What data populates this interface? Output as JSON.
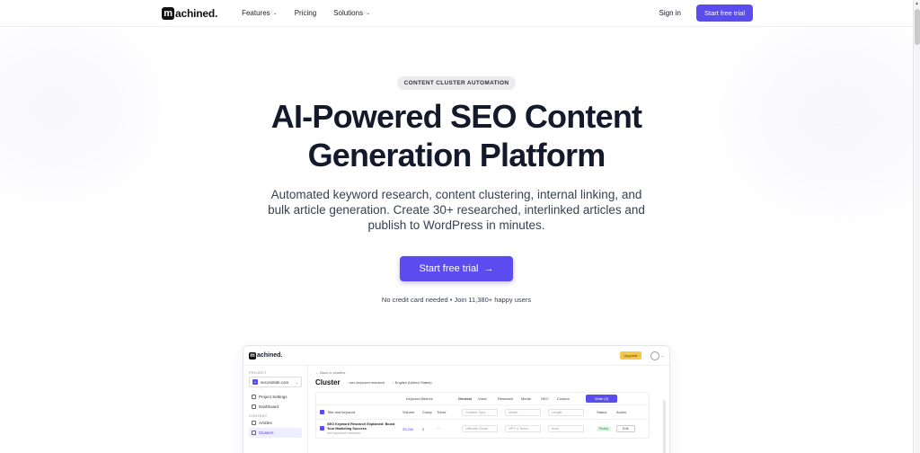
{
  "nav": {
    "logo_letter": "m",
    "logo_rest": "achined.",
    "links": [
      {
        "label": "Features",
        "chevron": true
      },
      {
        "label": "Pricing",
        "chevron": false
      },
      {
        "label": "Solutions",
        "chevron": true
      }
    ],
    "signin": "Sign in",
    "cta": "Start free trial"
  },
  "hero": {
    "badge": "CONTENT CLUSTER AUTOMATION",
    "title_line1": "AI-Powered SEO Content",
    "title_line2": "Generation Platform",
    "subtitle": "Automated keyword research, content clustering, internal linking, and bulk article generation. Create 30+ researched, interlinked articles and publish to WordPress in minutes.",
    "cta": "Start free trial",
    "cta_arrow": "→",
    "note": "No credit card needed • Join 11,380+ happy users"
  },
  "preview": {
    "logo_letter": "m",
    "logo_rest": "achined.",
    "upgrade": "Upgrade",
    "sidebar": {
      "project_label": "PROJECT",
      "project_name": "secondsite.com",
      "items": [
        "Project Settings",
        "Dashboard"
      ],
      "content_label": "CONTENT",
      "content_items": [
        "Articles",
        "Clusters"
      ]
    },
    "back": "← Back to clusters",
    "heading": "Cluster",
    "tag1": "seo keyword research",
    "tag2": "English (United States)",
    "table": {
      "group_header": "Keyword Metrics",
      "tabs": [
        "General",
        "Voice",
        "Research",
        "Media",
        "SEO",
        "Custom"
      ],
      "write_button": "Write (2)",
      "col_title": "Title and keyword",
      "col_volume": "Volume",
      "col_comp": "Comp",
      "col_trend": "Trend",
      "selects": [
        "Content Type",
        "Model",
        "Length"
      ],
      "col_status": "Status",
      "col_action": "Action",
      "row_title": "SEO Keyword Research Explained: Boost Your Marketing Success",
      "row_keyword": "seo keyword research",
      "row_volume": "33,200",
      "row_comp": "2",
      "row_type": "Ultimate Guide",
      "row_model": "GPT-4 Turbo",
      "row_length": "Auto",
      "row_status": "Ready",
      "row_action": "Edit"
    }
  }
}
